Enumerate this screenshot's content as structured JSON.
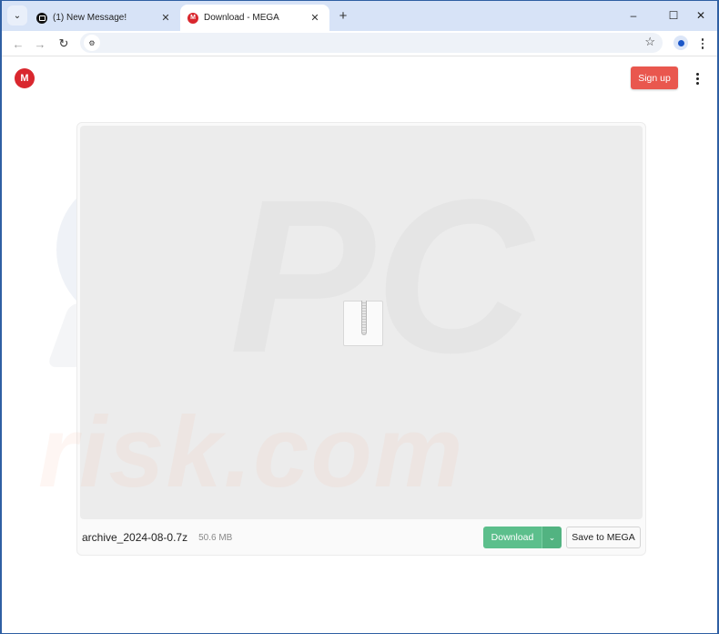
{
  "browser": {
    "tabs": [
      {
        "title": "(1) New Message!",
        "icon": "message-icon",
        "active": false
      },
      {
        "title": "Download - MEGA",
        "icon": "mega-logo-icon",
        "active": true
      }
    ],
    "tab_list_glyph": "⌄",
    "close_glyph": "✕",
    "new_tab_glyph": "+",
    "window_controls": {
      "minimize": "–",
      "maximize": "☐",
      "close": "✕"
    },
    "nav": {
      "back": "←",
      "forward": "→",
      "reload": "↻"
    },
    "address": "",
    "site_info_glyph": "⚙",
    "bookmark_glyph": "☆"
  },
  "page": {
    "logo_letter": "M",
    "signup_label": "Sign up",
    "file": {
      "name": "archive_2024-08-0.7z",
      "size": "50.6 MB",
      "type_icon": "zip-archive-icon"
    },
    "download_label": "Download",
    "download_arrow": "⌄",
    "save_label": "Save to MEGA"
  },
  "watermark": {
    "text": "risk.com",
    "big": "PC"
  },
  "colors": {
    "mega_red": "#d9272e",
    "signup_bg": "#e9574e",
    "download_green": "#5cbf8c",
    "tabbar_bg": "#d7e3f7",
    "window_border": "#2f5fa3"
  }
}
